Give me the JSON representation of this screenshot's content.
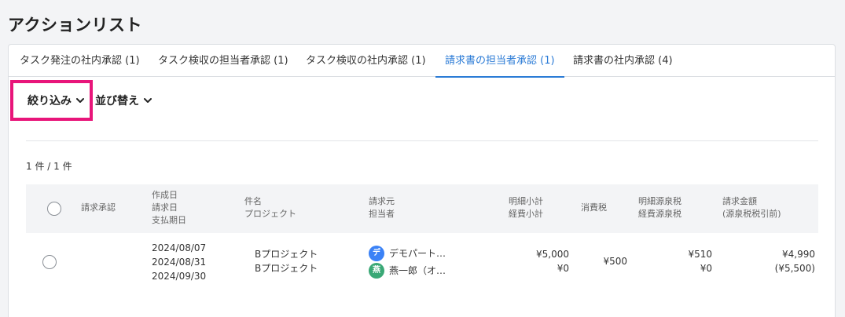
{
  "page": {
    "title": "アクションリスト"
  },
  "tabs": [
    {
      "label": "タスク発注の社内承認 (1)"
    },
    {
      "label": "タスク検収の担当者承認 (1)"
    },
    {
      "label": "タスク検収の社内承認 (1)"
    },
    {
      "label": "請求書の担当者承認 (1)",
      "active": true
    },
    {
      "label": "請求書の社内承認 (4)"
    }
  ],
  "toolbar": {
    "filter_label": "絞り込み",
    "sort_label": "並び替え"
  },
  "result": {
    "count_text": "1 件 / 1 件"
  },
  "table": {
    "headers": {
      "approval": "請求承認",
      "dates": [
        "作成日",
        "請求日",
        "支払期日"
      ],
      "subject": [
        "件名",
        "プロジェクト"
      ],
      "issuer": [
        "請求元",
        "担当者"
      ],
      "subtotal": [
        "明細小計",
        "経費小計"
      ],
      "tax": "消費税",
      "withholding": [
        "明細源泉税",
        "経費源泉税"
      ],
      "amount": [
        "請求金額",
        "(源泉税税引前)"
      ]
    },
    "rows": [
      {
        "dates": [
          "2024/08/07",
          "2024/08/31",
          "2024/09/30"
        ],
        "subject": [
          "Bプロジェクト",
          "Bプロジェクト"
        ],
        "issuer": {
          "avatar": "デ",
          "name": "デモパート…",
          "color": "#3b82f6"
        },
        "owner": {
          "avatar": "燕",
          "name": "燕一郎（オ…",
          "color": "#3aa876"
        },
        "subtotal": [
          "¥5,000",
          "¥0"
        ],
        "tax": "¥500",
        "withholding": [
          "¥510",
          "¥0"
        ],
        "amount": [
          "¥4,990",
          "(¥5,500)"
        ]
      }
    ]
  },
  "colors": {
    "accent": "#2b7bd6",
    "highlight": "#e8157a"
  }
}
